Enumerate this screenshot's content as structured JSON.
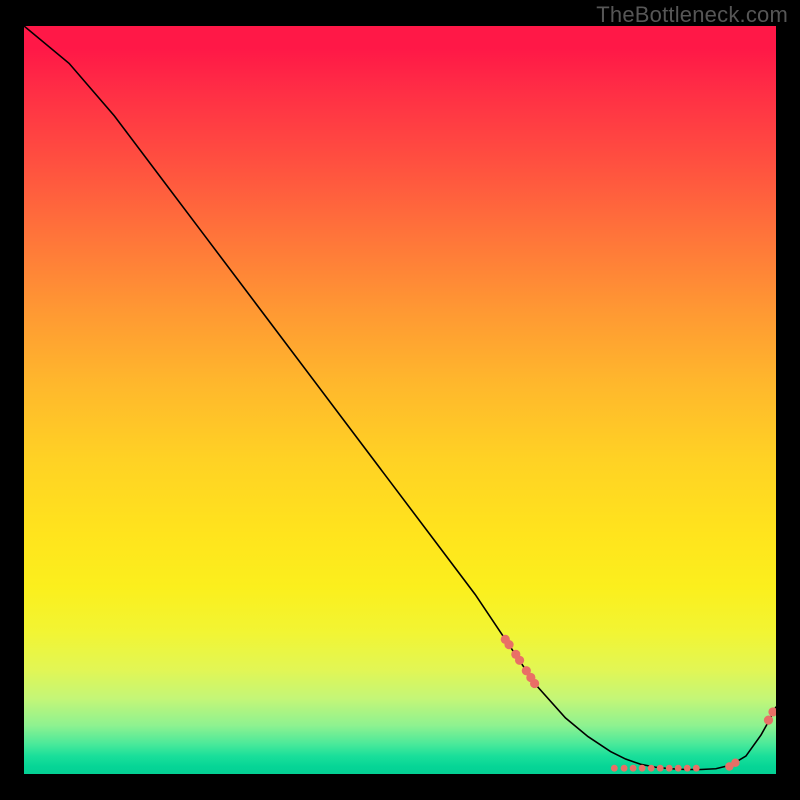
{
  "watermark": "TheBottleneck.com",
  "colors": {
    "dot": "#e96f66",
    "stroke": "#000000"
  },
  "chart_data": {
    "type": "line",
    "title": "",
    "xlabel": "",
    "ylabel": "",
    "xlim": [
      0,
      100
    ],
    "ylim": [
      0,
      100
    ],
    "grid": false,
    "legend": false,
    "line": {
      "name": "curve",
      "x": [
        0,
        6,
        12,
        18,
        24,
        30,
        36,
        42,
        48,
        54,
        60,
        64,
        68,
        72,
        75,
        78,
        80,
        82,
        84,
        86,
        88,
        90,
        92,
        94,
        96,
        98,
        99,
        100
      ],
      "y": [
        100,
        95,
        88,
        80,
        72,
        64,
        56,
        48,
        40,
        32,
        24,
        18,
        12,
        7.5,
        5,
        3,
        2,
        1.3,
        0.9,
        0.7,
        0.6,
        0.6,
        0.7,
        1.2,
        2.4,
        5.2,
        7.0,
        9.0
      ]
    },
    "dots": [
      {
        "x": 64.0,
        "y": 18.0
      },
      {
        "x": 64.5,
        "y": 17.3
      },
      {
        "x": 65.4,
        "y": 16.0
      },
      {
        "x": 65.9,
        "y": 15.2
      },
      {
        "x": 66.8,
        "y": 13.8
      },
      {
        "x": 67.4,
        "y": 12.9
      },
      {
        "x": 67.9,
        "y": 12.1
      },
      {
        "x": 78.5,
        "y": 0.78
      },
      {
        "x": 79.8,
        "y": 0.78
      },
      {
        "x": 81.0,
        "y": 0.78
      },
      {
        "x": 82.2,
        "y": 0.78
      },
      {
        "x": 83.4,
        "y": 0.78
      },
      {
        "x": 84.6,
        "y": 0.78
      },
      {
        "x": 85.8,
        "y": 0.78
      },
      {
        "x": 87.0,
        "y": 0.78
      },
      {
        "x": 88.2,
        "y": 0.78
      },
      {
        "x": 89.4,
        "y": 0.78
      },
      {
        "x": 93.8,
        "y": 1.0
      },
      {
        "x": 94.6,
        "y": 1.5
      },
      {
        "x": 99.0,
        "y": 7.2
      },
      {
        "x": 99.6,
        "y": 8.3
      }
    ],
    "dot_style": {
      "radius_primary": 4.6,
      "radius_secondary": 3.4
    }
  }
}
